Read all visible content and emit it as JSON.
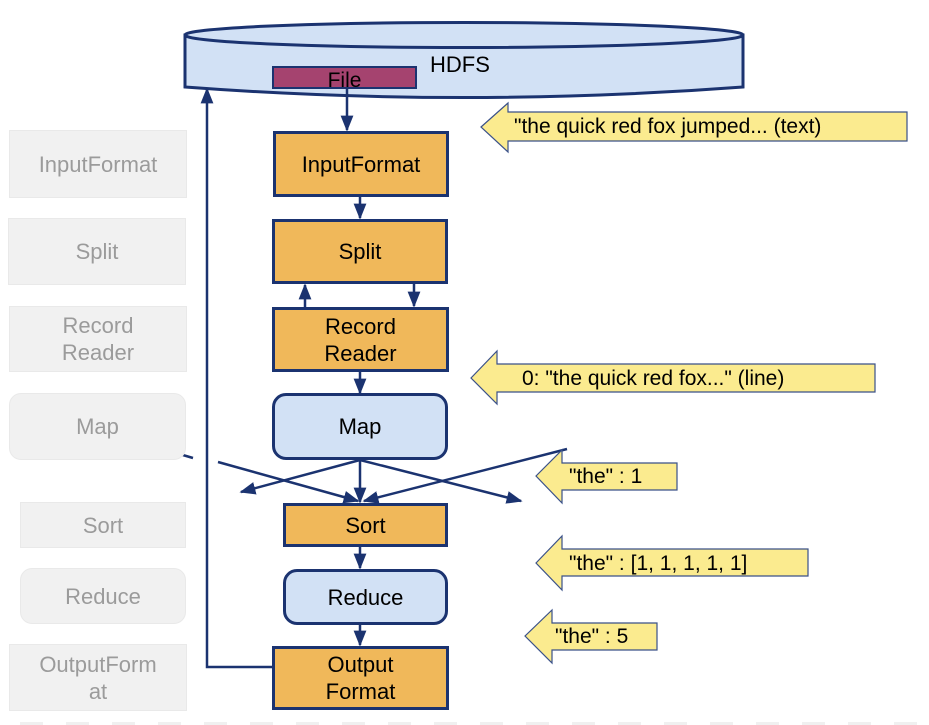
{
  "colors": {
    "stroke": "#1b3370",
    "orange_stage": "#f0b85a",
    "blue_stage": "#d2e1f5",
    "file": "#a5436f",
    "callout": "#fbeb8f",
    "ghost_bg": "#f1f1f1",
    "ghost_text": "#9b9b9b"
  },
  "storage": {
    "label": "HDFS",
    "file_label": "File"
  },
  "ghost_column": [
    {
      "label": "InputFormat"
    },
    {
      "label": "Split"
    },
    {
      "label": "Record\nReader"
    },
    {
      "label": "Map"
    },
    {
      "label": "Sort"
    },
    {
      "label": "Reduce"
    },
    {
      "label": "OutputForm\nat"
    }
  ],
  "pipeline": [
    {
      "label": "InputFormat",
      "kind": "orange"
    },
    {
      "label": "Split",
      "kind": "orange"
    },
    {
      "label": "Record\nReader",
      "kind": "orange"
    },
    {
      "label": "Map",
      "kind": "blue"
    },
    {
      "label": "Sort",
      "kind": "orange"
    },
    {
      "label": "Reduce",
      "kind": "blue"
    },
    {
      "label": "Output\nFormat",
      "kind": "orange"
    }
  ],
  "callouts": [
    {
      "text": "\"the quick red fox jumped... (text)"
    },
    {
      "text": "0: \"the quick red fox...\" (line)"
    },
    {
      "text": "\"the\" : 1"
    },
    {
      "text": "\"the\" : [1, 1, 1, 1, 1]"
    },
    {
      "text": "\"the\" : 5"
    }
  ]
}
